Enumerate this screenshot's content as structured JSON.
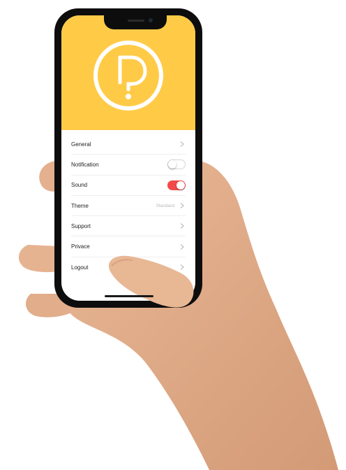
{
  "colors": {
    "header": "#ffcb47",
    "toggle_on": "#f24a4a",
    "phone": "#0d0d0d"
  },
  "header": {
    "logo_icon": "question-mark-logo-icon"
  },
  "settings": {
    "items": [
      {
        "label": "General",
        "control": "chevron"
      },
      {
        "label": "Notification",
        "control": "toggle",
        "state": "off"
      },
      {
        "label": "Sound",
        "control": "toggle",
        "state": "on"
      },
      {
        "label": "Theme",
        "control": "chevron",
        "value": "Standard"
      },
      {
        "label": "Support",
        "control": "chevron"
      },
      {
        "label": "Privace",
        "control": "chevron"
      },
      {
        "label": "Logout",
        "control": "chevron"
      }
    ]
  }
}
